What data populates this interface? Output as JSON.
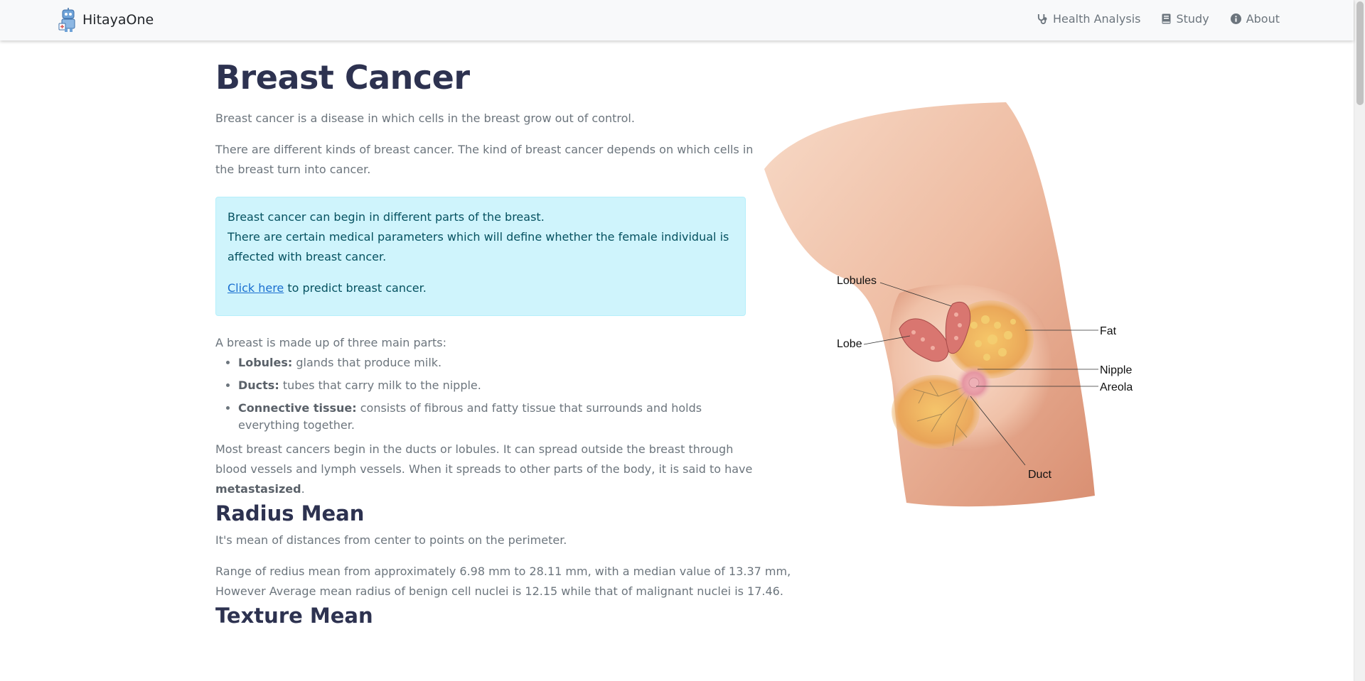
{
  "brand": {
    "name": "HitayaOne",
    "logo": "robot-logo-icon"
  },
  "nav": {
    "items": [
      {
        "label": "Health Analysis",
        "icon": "stethoscope-icon"
      },
      {
        "label": "Study",
        "icon": "book-icon"
      },
      {
        "label": "About",
        "icon": "info-circle-icon"
      }
    ]
  },
  "page": {
    "title": "Breast Cancer",
    "intro1": "Breast cancer is a disease in which cells in the breast grow out of control.",
    "intro2": "There are different kinds of breast cancer. The kind of breast cancer depends on which cells in the breast turn into cancer.",
    "alert": {
      "line1": "Breast cancer can begin in different parts of the breast.",
      "line2": "There are certain medical parameters which will define whether the female individual is affected with breast cancer.",
      "link": "Click here",
      "after_link": " to predict breast cancer."
    },
    "parts_intro": "A breast is made up of three main parts:",
    "parts": [
      {
        "term": "Lobules:",
        "desc": " glands that produce milk."
      },
      {
        "term": "Ducts:",
        "desc": " tubes that carry milk to the nipple."
      },
      {
        "term": "Connective tissue:",
        "desc": " consists of fibrous and fatty tissue that surrounds and holds everything together."
      }
    ],
    "spread_text": "Most breast cancers begin in the ducts or lobules. It can spread outside the breast through blood vessels and lymph vessels. When it spreads to other parts of the body, it is said to have ",
    "spread_bold": "metastasized",
    "spread_end": ".",
    "radius": {
      "title": "Radius Mean",
      "definition": "It's mean of distances from center to points on the perimeter.",
      "range": "Range of redius mean from approximately 6.98 mm to 28.11 mm, with a median value of 13.37 mm, However Average mean radius of benign cell nuclei is 12.15 while that of malignant nuclei is 17.46."
    },
    "texture": {
      "title": "Texture Mean"
    }
  },
  "illustration": {
    "labels": {
      "lobules": "Lobules",
      "lobe": "Lobe",
      "fat": "Fat",
      "nipple": "Nipple",
      "areola": "Areola",
      "duct": "Duct"
    }
  },
  "colors": {
    "heading": "#2d3250",
    "alert_bg": "#cff4fc",
    "alert_text": "#055160",
    "link": "#1a6fd0",
    "navbar_bg": "#f8f9fa"
  }
}
